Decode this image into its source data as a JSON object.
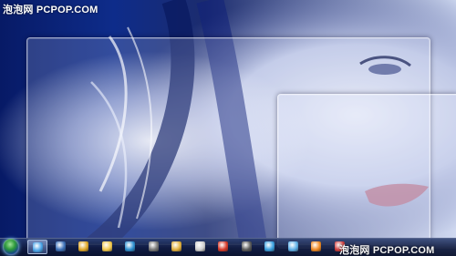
{
  "watermark": {
    "top": "泡泡网 PCPOP.COM",
    "bottom": "泡泡网 PCPOP.COM"
  },
  "windows": [
    {
      "name": "aero-peek-window-back",
      "style": "translucent glass outline"
    },
    {
      "name": "aero-peek-window-front",
      "style": "translucent glass outline"
    }
  ],
  "taskbar": {
    "start_button": "windows-start-orb",
    "items": [
      {
        "icon": "ie-browser-icon",
        "color": "#4aa3e8",
        "active": true
      },
      {
        "icon": "media-player-icon",
        "color": "#3b6fb8",
        "active": false
      },
      {
        "icon": "outlook-icon",
        "color": "#e0a82a",
        "active": false
      },
      {
        "icon": "folder-icon",
        "color": "#f2c94c",
        "active": false
      },
      {
        "icon": "arrow-app-icon",
        "color": "#2d8fd0",
        "active": false
      },
      {
        "icon": "camera-icon",
        "color": "#777777",
        "active": false
      },
      {
        "icon": "player-icon",
        "color": "#e3b03c",
        "active": false
      },
      {
        "icon": "mail-icon",
        "color": "#cfcfcf",
        "active": false
      },
      {
        "icon": "stop-icon",
        "color": "#d83a2a",
        "active": false
      },
      {
        "icon": "film-icon",
        "color": "#5a5a5a",
        "active": false
      },
      {
        "icon": "globe-icon",
        "color": "#3aa0e0",
        "active": false
      },
      {
        "icon": "chat-icon",
        "color": "#5fb0e8",
        "active": false
      },
      {
        "icon": "orange-app-icon",
        "color": "#f08a24",
        "active": false
      },
      {
        "icon": "user-icon",
        "color": "#d04040",
        "active": false
      }
    ]
  }
}
